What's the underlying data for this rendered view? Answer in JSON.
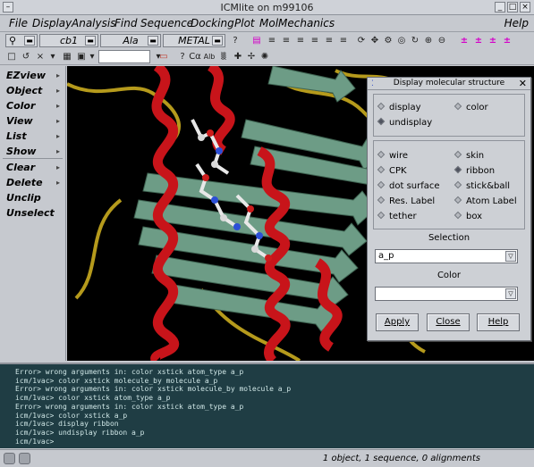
{
  "window": {
    "title": "ICMlite on m99106"
  },
  "menubar": {
    "items": [
      "File",
      "Display",
      "Analysis",
      "Find",
      "Sequence",
      "Docking",
      "Plot",
      "MolMechanics"
    ],
    "help": "Help"
  },
  "toolbar": {
    "combo1": "cb1",
    "combo2": "Ala",
    "combo3": "METAL",
    "atom_label_icon": "Alb"
  },
  "left_panel": {
    "items": [
      "EZview",
      "Object",
      "Color",
      "View",
      "List",
      "Show",
      "Clear",
      "Delete",
      "Unclip",
      "Unselect"
    ]
  },
  "dialog": {
    "title": "Display molecular structure",
    "mode_options": [
      "display",
      "color",
      "undisplay"
    ],
    "rep_options": [
      "wire",
      "skin",
      "CPK",
      "ribbon",
      "dot surface",
      "stick&ball",
      "Res. Label",
      "Atom Label",
      "tether",
      "box"
    ],
    "selection_label": "Selection",
    "selection_value": "a_p",
    "color_label": "Color",
    "color_value": "",
    "buttons": {
      "apply": "Apply",
      "close": "Close",
      "help": "Help"
    }
  },
  "console": {
    "lines": [
      "Error> wrong arguments in: color xstick atom_type a_p",
      "icm/1vac> color xstick molecule_by molecule a_p",
      "Error> wrong arguments in: color xstick molecule_by molecule a_p",
      "icm/1vac> color xstick atom_type a_p",
      "Error> wrong arguments in: color xstick atom_type a_p",
      "icm/1vac> color xstick a_p",
      "icm/1vac> display ribbon",
      "icm/1vac> undisplay ribbon a_p",
      "icm/1vac>"
    ]
  },
  "statusbar": {
    "text": "1 object, 1 sequence, 0 alignments"
  }
}
